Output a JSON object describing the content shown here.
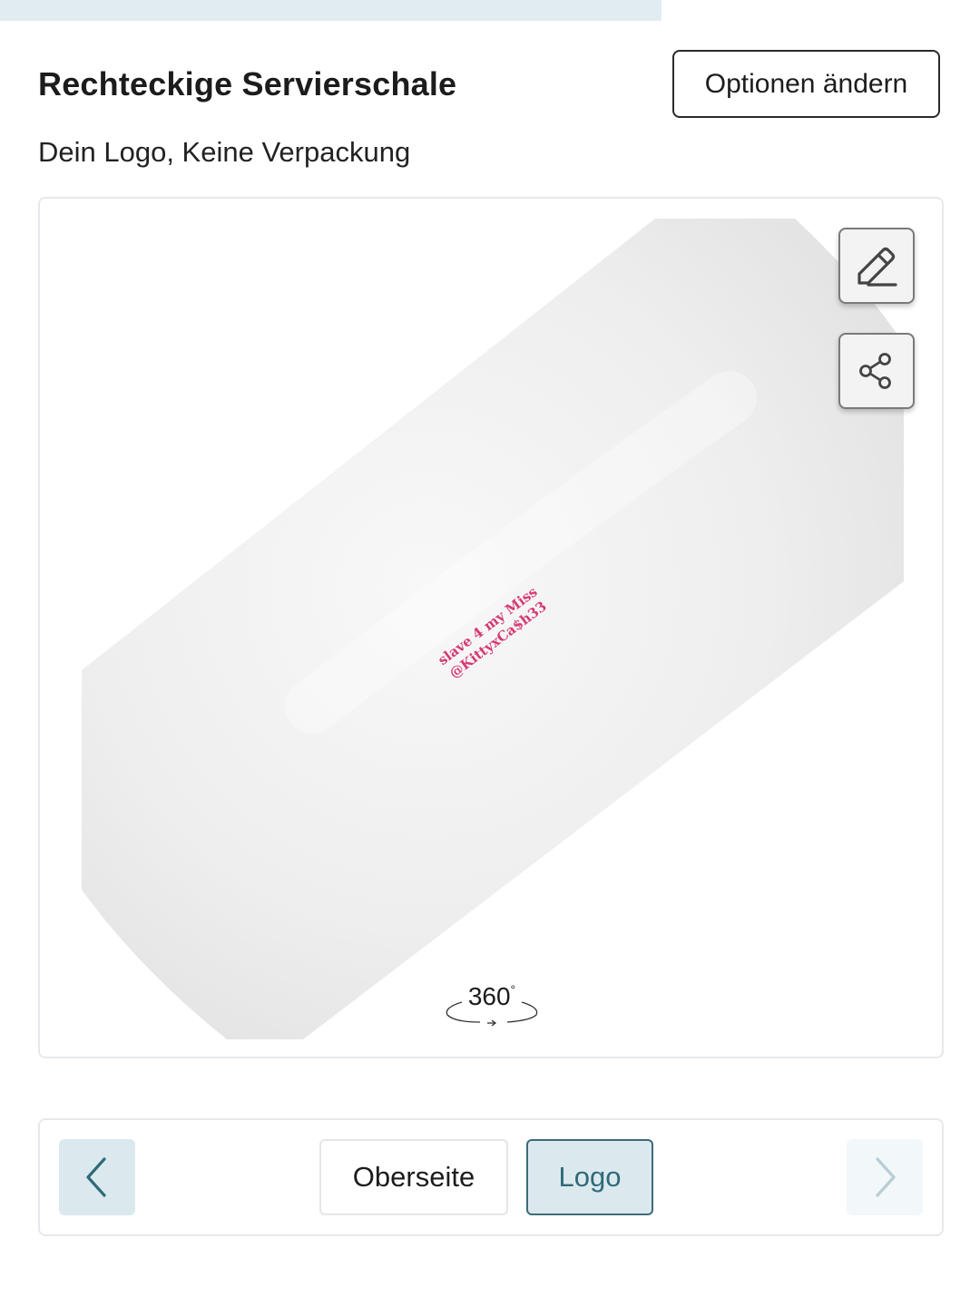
{
  "progress": {
    "fraction": 0.68,
    "fill_color": "#e1ecf1"
  },
  "product": {
    "title": "Rechteckige Servierschale",
    "options_button_label": "Optionen ändern",
    "subtitle": "Dein Logo, Keine Verpackung"
  },
  "viewer": {
    "logo_text_line1": "slave 4 my Miss",
    "logo_text_line2": "@KittyxCa$h33",
    "logo_color": "#d63a74",
    "rotate_label": "360",
    "rotate_degree_mark": "°",
    "tools": [
      {
        "icon": "pencil-icon"
      },
      {
        "icon": "share-icon"
      }
    ]
  },
  "view_nav": {
    "prev_icon": "chevron-left-icon",
    "next_icon": "chevron-right-icon",
    "tabs": [
      {
        "label": "Oberseite",
        "selected": false
      },
      {
        "label": "Logo",
        "selected": true
      }
    ],
    "accent_color": "#2f6a78"
  }
}
